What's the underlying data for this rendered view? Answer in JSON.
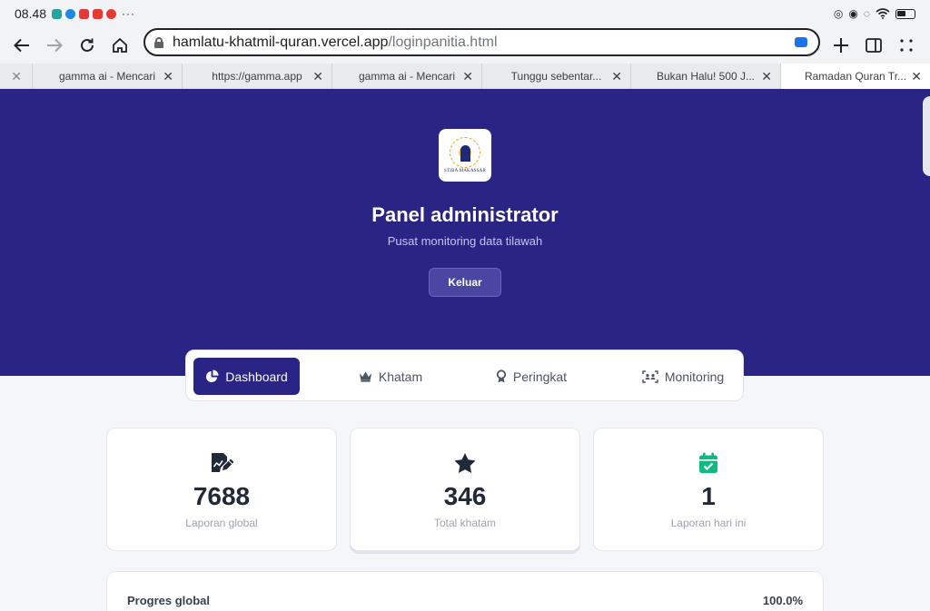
{
  "status_bar": {
    "time": "08.48",
    "more": "···"
  },
  "browser": {
    "url_host": "hamlatu-khatmil-quran.vercel.app",
    "url_path": "/loginpanitia.html",
    "tabs": [
      {
        "label": ""
      },
      {
        "label": "gamma ai - Mencari"
      },
      {
        "label": "https://gamma.app"
      },
      {
        "label": "gamma ai - Mencari"
      },
      {
        "label": "Tunggu sebentar..."
      },
      {
        "label": "Bukan Halu! 500 J..."
      },
      {
        "label": "Ramadan Quran Tr..."
      }
    ],
    "close_glyph": "✕"
  },
  "hero": {
    "logo_text": "STIBA MAKASSAR",
    "title": "Panel administrator",
    "subtitle": "Pusat monitoring data tilawah",
    "logout_label": "Keluar"
  },
  "nav": {
    "tabs": [
      {
        "label": "Dashboard",
        "icon": "pie-chart-icon",
        "active": true
      },
      {
        "label": "Khatam",
        "icon": "crown-icon",
        "active": false
      },
      {
        "label": "Peringkat",
        "icon": "medal-icon",
        "active": false
      },
      {
        "label": "Monitoring",
        "icon": "users-scan-icon",
        "active": false
      }
    ]
  },
  "stats": [
    {
      "value": "7688",
      "label": "Laporan global",
      "icon": "edit-report-icon",
      "color": "#1f2937"
    },
    {
      "value": "346",
      "label": "Total khatam",
      "icon": "star-icon",
      "color": "#1f2937"
    },
    {
      "value": "1",
      "label": "Laporan hari ini",
      "icon": "calendar-check-icon",
      "color": "#10b981"
    }
  ],
  "progress": {
    "label": "Progres global",
    "value": "100.0%"
  },
  "colors": {
    "primary": "#2a2485",
    "accent_green": "#10b981"
  }
}
